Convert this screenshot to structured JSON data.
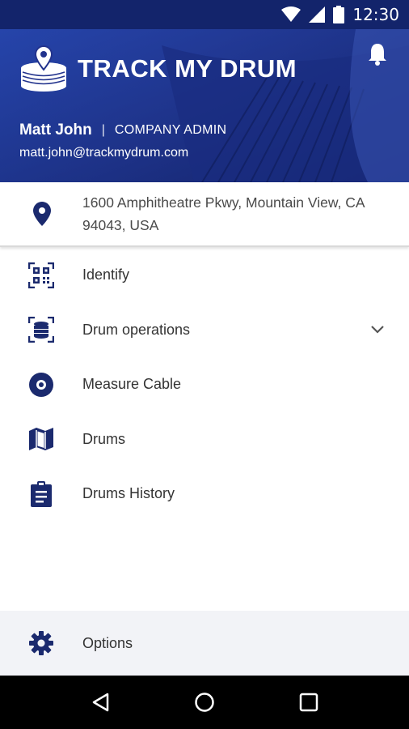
{
  "status_bar": {
    "time": "12:30",
    "icons": [
      "wifi-icon",
      "signal-icon",
      "battery-icon"
    ]
  },
  "header": {
    "brand_title": "TRACK MY DRUM",
    "user_name": "Matt John",
    "separator": "|",
    "user_role": "COMPANY ADMIN",
    "user_email": "matt.john@trackmydrum.com",
    "icons": [
      "drum-logo-icon",
      "bell-icon"
    ]
  },
  "location": {
    "address": "1600 Amphitheatre Pkwy, Mountain View, CA 94043, USA",
    "icon": "location-pin-icon"
  },
  "menu": {
    "items": [
      {
        "label": "Identify",
        "icon": "qr-scan-icon"
      },
      {
        "label": "Drum operations",
        "icon": "drum-stack-icon",
        "expandable": true
      },
      {
        "label": "Measure Cable",
        "icon": "disc-icon"
      },
      {
        "label": "Drums",
        "icon": "map-icon"
      },
      {
        "label": "Drums History",
        "icon": "clipboard-icon"
      }
    ]
  },
  "options": {
    "label": "Options",
    "icon": "gear-icon"
  },
  "nav_bar": {
    "buttons": [
      "back-icon",
      "home-icon",
      "recents-icon"
    ]
  },
  "colors": {
    "primary": "#13246b",
    "header_bg": "#22338d",
    "icon": "#1b2a6e",
    "footer_bg": "#f2f3f7"
  }
}
